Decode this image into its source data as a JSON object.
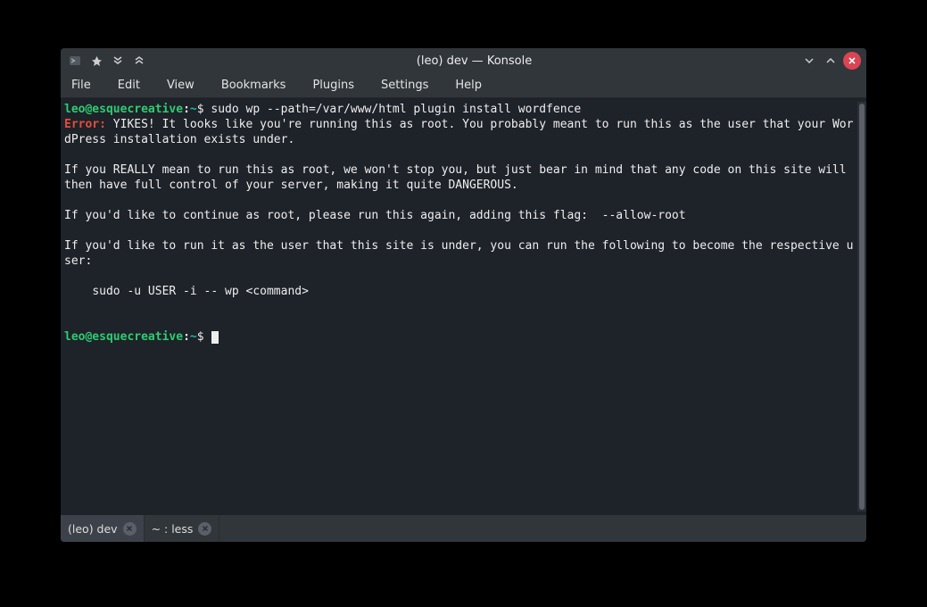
{
  "window": {
    "title": "(leo) dev — Konsole"
  },
  "menubar": {
    "items": [
      "File",
      "Edit",
      "View",
      "Bookmarks",
      "Plugins",
      "Settings",
      "Help"
    ]
  },
  "terminal": {
    "prompt1": {
      "user": "leo@esquecreative",
      "colon": ":",
      "path": "~",
      "dollar": "$ ",
      "command": "sudo wp --path=/var/www/html plugin install wordfence"
    },
    "error_label": "Error:",
    "error_body": " YIKES! It looks like you're running this as root. You probably meant to run this as the user that your WordPress installation exists under.",
    "blank1": " ",
    "para2": "If you REALLY mean to run this as root, we won't stop you, but just bear in mind that any code on this site will then have full control of your server, making it quite DANGEROUS.",
    "blank2": " ",
    "para3": "If you'd like to continue as root, please run this again, adding this flag:  --allow-root",
    "blank3": " ",
    "para4": "If you'd like to run it as the user that this site is under, you can run the following to become the respective user:",
    "blank4": " ",
    "indent_cmd": "    sudo -u USER -i -- wp <command>",
    "blank5": " ",
    "blank6": " ",
    "prompt2": {
      "user": "leo@esquecreative",
      "colon": ":",
      "path": "~",
      "dollar": "$ "
    }
  },
  "tabs": [
    {
      "label": "(leo) dev",
      "active": true
    },
    {
      "label": "~ : less",
      "active": false
    }
  ]
}
